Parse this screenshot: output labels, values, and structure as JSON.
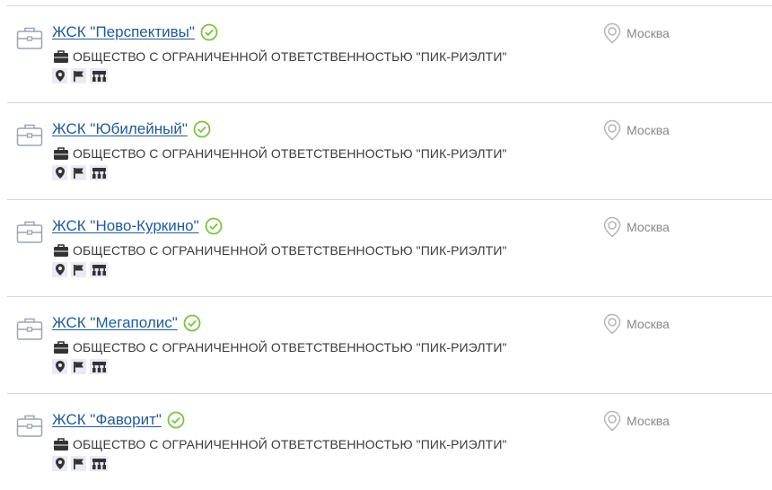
{
  "icons": {
    "organization": "briefcase-outline-icon",
    "verified": "check-circle-icon",
    "parent_company": "briefcase-icon",
    "location": "map-pin-outline-icon",
    "badge_address": "map-marker-icon",
    "badge_flag": "flag-icon",
    "badge_structure": "org-structure-icon"
  },
  "colors": {
    "link": "#1f5a99",
    "verified": "#7cc242",
    "badge_bg": "#eaeaf6",
    "icon_dark": "#333333",
    "muted": "#888888",
    "divider": "#d6d6d6"
  },
  "items": [
    {
      "title": "ЖСК \"Перспективы\"",
      "parent": "ОБЩЕСТВО С ОГРАНИЧЕННОЙ ОТВЕТСТВЕННОСТЬЮ \"ПИК-РИЭЛТИ\"",
      "city": "Москва"
    },
    {
      "title": "ЖСК \"Юбилейный\"",
      "parent": "ОБЩЕСТВО С ОГРАНИЧЕННОЙ ОТВЕТСТВЕННОСТЬЮ \"ПИК-РИЭЛТИ\"",
      "city": "Москва"
    },
    {
      "title": "ЖСК \"Ново-Куркино\"",
      "parent": "ОБЩЕСТВО С ОГРАНИЧЕННОЙ ОТВЕТСТВЕННОСТЬЮ \"ПИК-РИЭЛТИ\"",
      "city": "Москва"
    },
    {
      "title": "ЖСК \"Мегаполис\"",
      "parent": "ОБЩЕСТВО С ОГРАНИЧЕННОЙ ОТВЕТСТВЕННОСТЬЮ \"ПИК-РИЭЛТИ\"",
      "city": "Москва"
    },
    {
      "title": "ЖСК \"Фаворит\"",
      "parent": "ОБЩЕСТВО С ОГРАНИЧЕННОЙ ОТВЕТСТВЕННОСТЬЮ \"ПИК-РИЭЛТИ\"",
      "city": "Москва"
    }
  ]
}
